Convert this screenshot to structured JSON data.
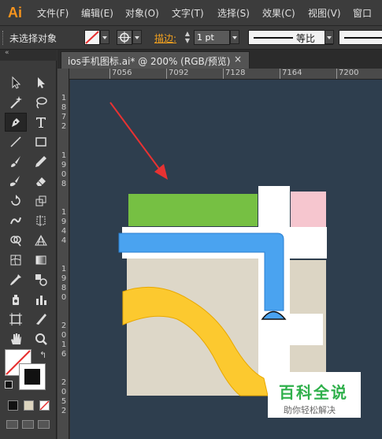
{
  "app": {
    "logo": "Ai"
  },
  "menu": [
    "文件(F)",
    "编辑(E)",
    "对象(O)",
    "文字(T)",
    "选择(S)",
    "效果(C)",
    "视图(V)",
    "窗口"
  ],
  "control_bar": {
    "selection_status": "未选择对象",
    "stroke_label": "描边:",
    "stroke_weight": "1 pt",
    "profile_label": "等比"
  },
  "tools_header": "«",
  "document": {
    "tab_title": "ios手机图标.ai* @ 200% (RGB/预览)",
    "close": "×"
  },
  "ruler_h": [
    "7056",
    "7092",
    "7128",
    "7164",
    "7200"
  ],
  "ruler_v": [
    [
      "1",
      "8",
      "7",
      "2"
    ],
    [
      "1",
      "9",
      "0",
      "8"
    ],
    [
      "1",
      "9",
      "4",
      "4"
    ],
    [
      "1",
      "9",
      "8",
      "0"
    ],
    [
      "2",
      "0",
      "1",
      "6"
    ],
    [
      "2",
      "0",
      "5",
      "2"
    ]
  ],
  "icons": {
    "tools": [
      "selection-icon",
      "direct-selection-icon",
      "magic-wand-icon",
      "lasso-icon",
      "pen-icon",
      "type-icon",
      "line-icon",
      "rectangle-icon",
      "paintbrush-icon",
      "pencil-icon",
      "blob-brush-icon",
      "eraser-icon",
      "rotate-icon",
      "scale-icon",
      "warp-icon",
      "free-transform-icon",
      "shape-builder-icon",
      "perspective-grid-icon",
      "mesh-icon",
      "gradient-icon",
      "eyedropper-icon",
      "blend-icon",
      "symbol-sprayer-icon",
      "column-graph-icon",
      "artboard-icon",
      "slice-icon",
      "hand-icon",
      "zoom-icon"
    ]
  },
  "colors": {
    "canvas_bg": "#2e3e4e",
    "green": "#76c043",
    "pink": "#f6c6cf",
    "blue": "#4aa3f0",
    "yellow": "#fcc92f",
    "land": "#ddd7c8",
    "arrow": "#e83232"
  },
  "watermark": {
    "title": "百科全说",
    "subtitle": "助你轻松解决"
  }
}
